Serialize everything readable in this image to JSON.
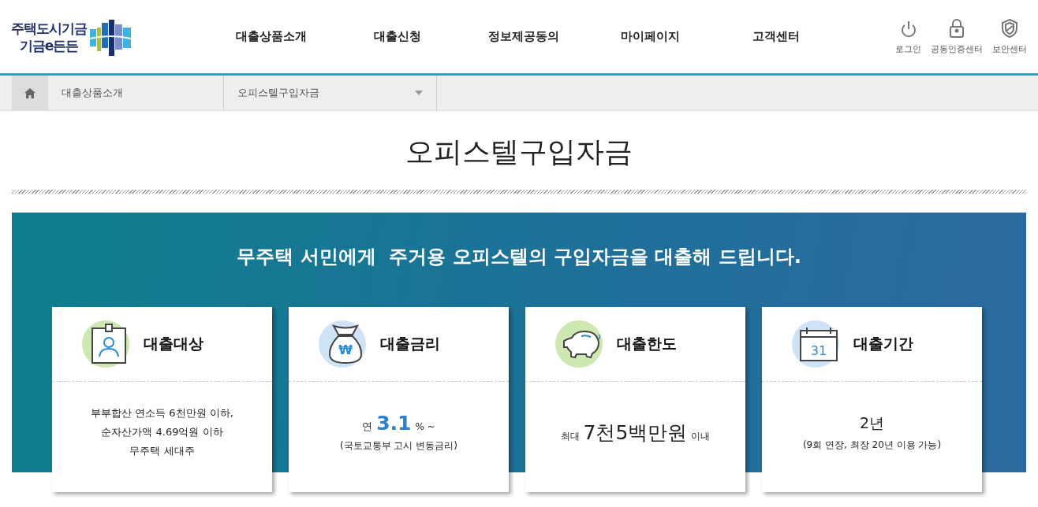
{
  "logo": {
    "line1": "주택도시기금",
    "line2": "기금e든든"
  },
  "nav": [
    {
      "label": "대출상품소개"
    },
    {
      "label": "대출신청"
    },
    {
      "label": "정보제공동의"
    },
    {
      "label": "마이페이지"
    },
    {
      "label": "고객센터"
    }
  ],
  "utility": [
    {
      "label": "로그인",
      "kind": "power"
    },
    {
      "label": "공동인증센터",
      "kind": "lock"
    },
    {
      "label": "보안센터",
      "kind": "shield"
    }
  ],
  "breadcrumb": {
    "section": "대출상품소개",
    "current": "오피스텔구입자금"
  },
  "page_title": "오피스텔구입자금",
  "banner": {
    "headline": "무주택 서민에게  주거용 오피스텔의 구입자금을 대출해 드립니다."
  },
  "cards": [
    {
      "title": "대출대상",
      "kind": "badge",
      "color": "#cde8b0",
      "lines": [
        [
          {
            "text": "부부합산 연소득 6천만원 이하,",
            "kind": "body",
            "accent": false
          }
        ],
        [
          {
            "text": "순자산가액 4.69억원 이하",
            "kind": "body",
            "accent": false
          }
        ],
        [
          {
            "text": "무주택 세대주",
            "kind": "body",
            "accent": false
          }
        ]
      ]
    },
    {
      "title": "대출금리",
      "kind": "moneybag",
      "icon_text": "₩",
      "color": "#cfe3f7",
      "lines": [
        [
          {
            "text": "연",
            "kind": "body",
            "accent": false
          },
          {
            "text": "3.1",
            "kind": "figure",
            "accent": true
          },
          {
            "text": "% ~",
            "kind": "note",
            "accent": false
          }
        ],
        [
          {
            "text": "(국토교통부 고시 변동금리)",
            "kind": "note",
            "accent": false
          }
        ]
      ]
    },
    {
      "title": "대출한도",
      "kind": "piggy",
      "color": "#cde8b0",
      "lines": [
        [
          {
            "text": "최대",
            "kind": "note",
            "accent": false
          },
          {
            "text": "7천5백만원",
            "kind": "figure",
            "accent": false
          },
          {
            "text": "이내",
            "kind": "note",
            "accent": false
          }
        ]
      ]
    },
    {
      "title": "대출기간",
      "kind": "calendar",
      "icon_text": "31",
      "color": "#cfe3f7",
      "lines": [
        [
          {
            "text": "2년",
            "kind": "lead",
            "accent": false
          }
        ],
        [
          {
            "text": "(9회 연장, 최장 20년 이용 가능)",
            "kind": "note",
            "accent": false
          }
        ]
      ]
    }
  ]
}
